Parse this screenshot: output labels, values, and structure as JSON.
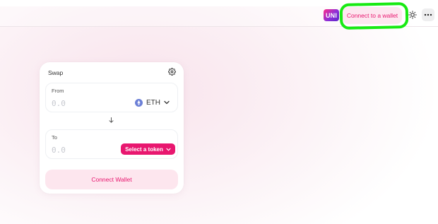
{
  "header": {
    "token_badge": "UNI",
    "connect_label": "Connect to a wallet",
    "theme_icon": "sun-icon",
    "more_icon": "ellipsis-icon",
    "highlight_color": "#18ea13"
  },
  "swap": {
    "title": "Swap",
    "settings_icon": "gear-icon",
    "from": {
      "label": "From",
      "amount_placeholder": "0.0",
      "token": "ETH",
      "token_icon": "ethereum-icon"
    },
    "switch_icon": "arrow-down-icon",
    "to": {
      "label": "To",
      "amount_placeholder": "0.0",
      "select_label": "Select a token"
    },
    "connect_label": "Connect Wallet"
  },
  "colors": {
    "accent": "#e8176f",
    "accent_soft": "#fde6ee"
  }
}
